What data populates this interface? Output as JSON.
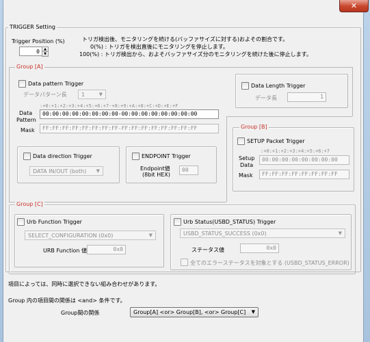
{
  "window": {
    "close_icon": "close-icon",
    "close_glyph": "✕"
  },
  "trigger": {
    "title": "TRIGGER Setting",
    "position_label": "Trigger Position (%)",
    "position_value": "0",
    "desc1": "トリガ検出後、モニタリングを続ける(バッファサイズに対する)およその割合です。",
    "desc2": "0(%) : トリガを検出直後にモニタリングを停止します。",
    "desc3": "100(%) : トリガ検出から、およそバッファサイズ分のモニタリングを続けた後に停止します。"
  },
  "group_a": {
    "legend": "Group [A]",
    "data_pattern": {
      "label": "Data pattern Trigger",
      "len_label": "データパターン長",
      "len_value": "1",
      "ruler": ":+0:+1:+2:+3:+4:+5:+6:+7-+8:+9:+A:+8:+C:+D:+E:+F",
      "pattern_label_1": "Data",
      "pattern_label_2": "Pattern",
      "pattern_value": "00:00:00:00:00:00:00:00-00:00:00:00:00:00:00:00",
      "mask_label": "Mask",
      "mask_value": "FF:FF:FF:FF:FF:FF:FF:FF-FF:FF:FF:FF:FF:FF:FF:FF"
    },
    "data_length": {
      "label": "Data Length Trigger",
      "len_label": "データ長",
      "len_value": "1"
    },
    "data_direction": {
      "label": "Data direction Trigger",
      "value": "DATA IN/OUT (both)"
    },
    "endpoint": {
      "label": "ENDPOINT Trigger",
      "value_label_1": "Endpoint値",
      "value_label_2": "(8bit HEX)",
      "value": "00"
    }
  },
  "group_b": {
    "legend": "Group [B]",
    "setup_packet": {
      "label": "SETUP Packet Trigger",
      "ruler": ":+0:+1:+2:+3:+4:+5:+6:+7",
      "data_label_1": "Setup",
      "data_label_2": "Data",
      "data_value": "00:00:00:00:00:00:00:00",
      "mask_label": "Mask",
      "mask_value": "FF:FF:FF:FF:FF:FF:FF:FF"
    }
  },
  "group_c": {
    "legend": "Group [C]",
    "urb_function": {
      "label": "Urb Function Trigger",
      "select_value": "SELECT_CONFIGURATION (0x0)",
      "value_label": "URB Function 値",
      "value": "0x0"
    },
    "urb_status": {
      "label": "Urb Status(USBD_STATUS) Trigger",
      "select_value": "USBD_STATUS_SUCCESS (0x0)",
      "value_label": "ステータス値",
      "value": "0x0",
      "all_errors_label": "全てのエラーステータスを対象とする (USBD_STATUS_ERROR)"
    }
  },
  "footer": {
    "note": "項目によっては、同時に選択できない組み合わせがあります。",
    "relation_note": "Group 内の項目間の関係は <and> 条件です。",
    "relation_label": "Group間の関係",
    "relation_value": "Group[A] <or> Group[B], <or> Group[C]"
  },
  "colors": {
    "group_legend": "#c8322a",
    "disabled_text": "#8c8c8c"
  }
}
